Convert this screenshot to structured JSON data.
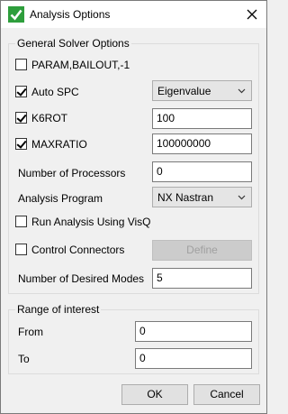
{
  "window": {
    "title": "Analysis Options"
  },
  "general": {
    "group_label": "General Solver Options",
    "bailout": {
      "label": "PARAM,BAILOUT,-1",
      "checked": false
    },
    "auto_spc": {
      "label": "Auto SPC",
      "checked": true,
      "value": "Eigenvalue"
    },
    "k6rot": {
      "label": "K6ROT",
      "checked": true,
      "value": "100"
    },
    "maxratio": {
      "label": "MAXRATIO",
      "checked": true,
      "value": "100000000"
    },
    "processors": {
      "label": "Number of Processors",
      "value": "0"
    },
    "program": {
      "label": "Analysis Program",
      "value": "NX Nastran"
    },
    "visq": {
      "label": "Run Analysis Using VisQ",
      "checked": false
    },
    "connectors": {
      "label": "Control Connectors",
      "checked": false,
      "button": "Define"
    },
    "modes": {
      "label": "Number of Desired Modes",
      "value": "5"
    }
  },
  "range": {
    "group_label": "Range of interest",
    "from": {
      "label": "From",
      "value": "0"
    },
    "to": {
      "label": "To",
      "value": "0"
    }
  },
  "footer": {
    "ok": "OK",
    "cancel": "Cancel"
  }
}
